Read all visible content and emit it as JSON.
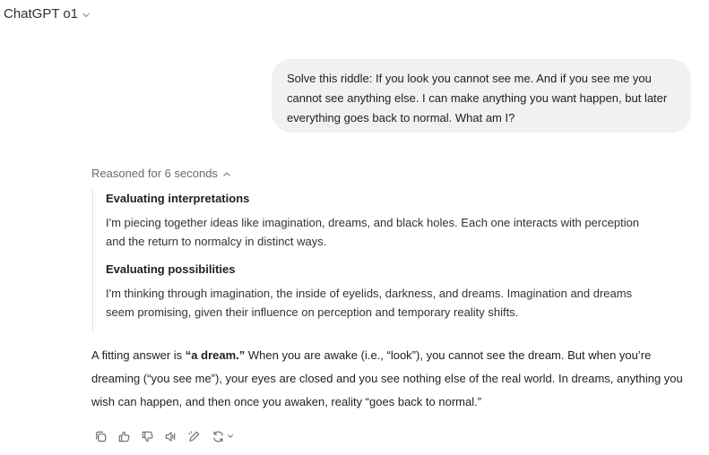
{
  "header": {
    "model_name": "ChatGPT o1"
  },
  "user_message": {
    "text": "Solve this riddle: If you look you cannot see me. And if you see me you cannot see anything else. I can make anything you want happen, but later everything goes back to normal. What am I?"
  },
  "reasoning": {
    "toggle_label": "Reasoned for 6 seconds",
    "steps": [
      {
        "title": "Evaluating interpretations",
        "body": "I'm piecing together ideas like imagination, dreams, and black holes. Each one interacts with perception and the return to normalcy in distinct ways."
      },
      {
        "title": "Evaluating possibilities",
        "body": "I'm thinking through imagination, the inside of eyelids, darkness, and dreams. Imagination and dreams seem promising, given their influence on perception and temporary reality shifts."
      }
    ]
  },
  "answer": {
    "prefix": "A fitting answer is ",
    "bold": "“a dream.”",
    "rest": " When you are awake (i.e., “look”), you cannot see the dream. But when you’re dreaming (“you see me”), your eyes are closed and you see nothing else of the real world. In dreams, anything you wish can happen, and then once you awaken, reality “goes back to normal.”"
  },
  "actions": {
    "icons": [
      "copy-icon",
      "thumbs-up-icon",
      "thumbs-down-icon",
      "read-aloud-icon",
      "edit-icon",
      "regenerate-icon"
    ]
  }
}
